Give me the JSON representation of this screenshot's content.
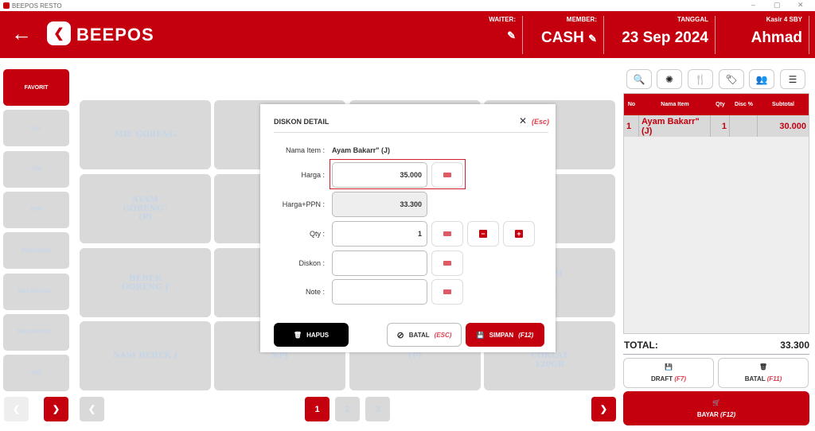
{
  "window": {
    "title": "BEEPOS RESTO",
    "controls": [
      "–",
      "▢",
      "✕"
    ]
  },
  "header": {
    "brand": "BEEPOS",
    "waiter_label": "WAITER:",
    "member_label": "MEMBER:",
    "member_value": "CASH",
    "date_label": "TANGGAL",
    "date_value": "23 Sep 2024",
    "cashier_label": "Kasir 4 SBY",
    "cashier_value": "Ahmad"
  },
  "categories": [
    "FAVORIT",
    "ALL",
    "ATK",
    "MINI",
    "MAKANAN",
    "MAKANANA...",
    "MAKANANG...",
    "MIE"
  ],
  "tiles": [
    "MIE GORENG",
    "",
    "",
    "(P)",
    "AYAM\nGORENG\"\n(P)",
    "",
    "",
    "(J)",
    "BEBEK\nGORENG J",
    "",
    "",
    "AYAM\nG\nNG",
    "NASI BEBEK J",
    "NPJ",
    "(P)",
    "R\nCOKLAT\n120GR"
  ],
  "pages": [
    "1",
    "2",
    "3"
  ],
  "modal": {
    "title": "DISKON DETAIL",
    "close_key": "(Esc)",
    "item_label": "Nama Item :",
    "item_value": "Ayam Bakarr\" (J)",
    "harga_label": "Harga :",
    "harga_value": "35.000",
    "ppn_label": "Harga+PPN :",
    "ppn_value": "33.300",
    "qty_label": "Qty :",
    "qty_value": "1",
    "diskon_label": "Diskon :",
    "diskon_value": "",
    "note_label": "Note :",
    "note_value": "",
    "hapus": "HAPUS",
    "batal": "BATAL",
    "batal_key": "(ESC)",
    "simpan": "SIMPAN",
    "simpan_key": "(F12)"
  },
  "order": {
    "columns": [
      "No",
      "Nama Item",
      "Qty",
      "Disc %",
      "Subtotal"
    ],
    "rows": [
      {
        "no": "1",
        "item": "Ayam Bakarr\" (J)",
        "qty": "1",
        "disc": "",
        "subtotal": "30.000"
      }
    ],
    "total_label": "TOTAL:",
    "total_value": "33.300",
    "draft": "DRAFT",
    "draft_key": "(F7)",
    "batal": "BATAL",
    "batal_key": "(F11)",
    "bayar": "BAYAR",
    "bayar_key": "(F12)"
  },
  "colors": {
    "primary": "#c4000f"
  }
}
